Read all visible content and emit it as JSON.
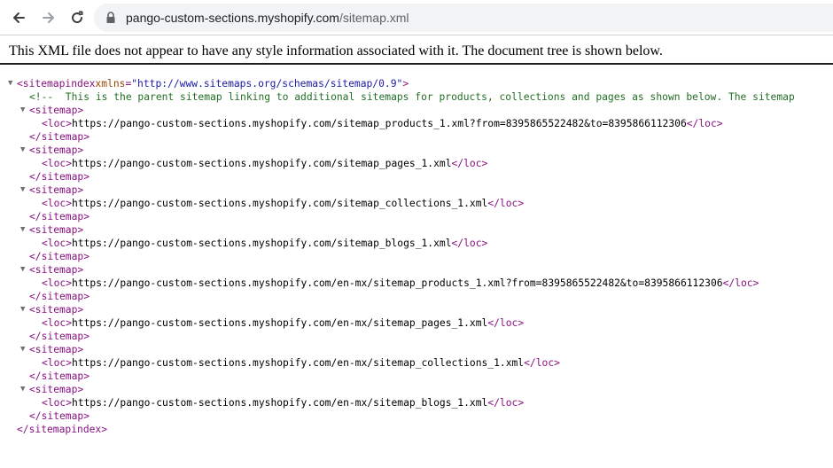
{
  "browser": {
    "url_host": "pango-custom-sections.myshopify.com",
    "url_path": "/sitemap.xml"
  },
  "notice": "This XML file does not appear to have any style information associated with it. The document tree is shown below.",
  "xml": {
    "root_tag": "sitemapindex",
    "root_attr_name": "xmlns",
    "root_attr_value": "\"http://www.sitemaps.org/schemas/sitemap/0.9\"",
    "comment": "<!--  This is the parent sitemap linking to additional sitemaps for products, collections and pages as shown below. The sitemap",
    "child_tag": "sitemap",
    "loc_tag": "loc",
    "sitemaps": [
      {
        "loc": "https://pango-custom-sections.myshopify.com/sitemap_products_1.xml?from=8395865522482&to=8395866112306"
      },
      {
        "loc": "https://pango-custom-sections.myshopify.com/sitemap_pages_1.xml"
      },
      {
        "loc": "https://pango-custom-sections.myshopify.com/sitemap_collections_1.xml"
      },
      {
        "loc": "https://pango-custom-sections.myshopify.com/sitemap_blogs_1.xml"
      },
      {
        "loc": "https://pango-custom-sections.myshopify.com/en-mx/sitemap_products_1.xml?from=8395865522482&to=8395866112306"
      },
      {
        "loc": "https://pango-custom-sections.myshopify.com/en-mx/sitemap_pages_1.xml"
      },
      {
        "loc": "https://pango-custom-sections.myshopify.com/en-mx/sitemap_collections_1.xml"
      },
      {
        "loc": "https://pango-custom-sections.myshopify.com/en-mx/sitemap_blogs_1.xml"
      }
    ]
  }
}
